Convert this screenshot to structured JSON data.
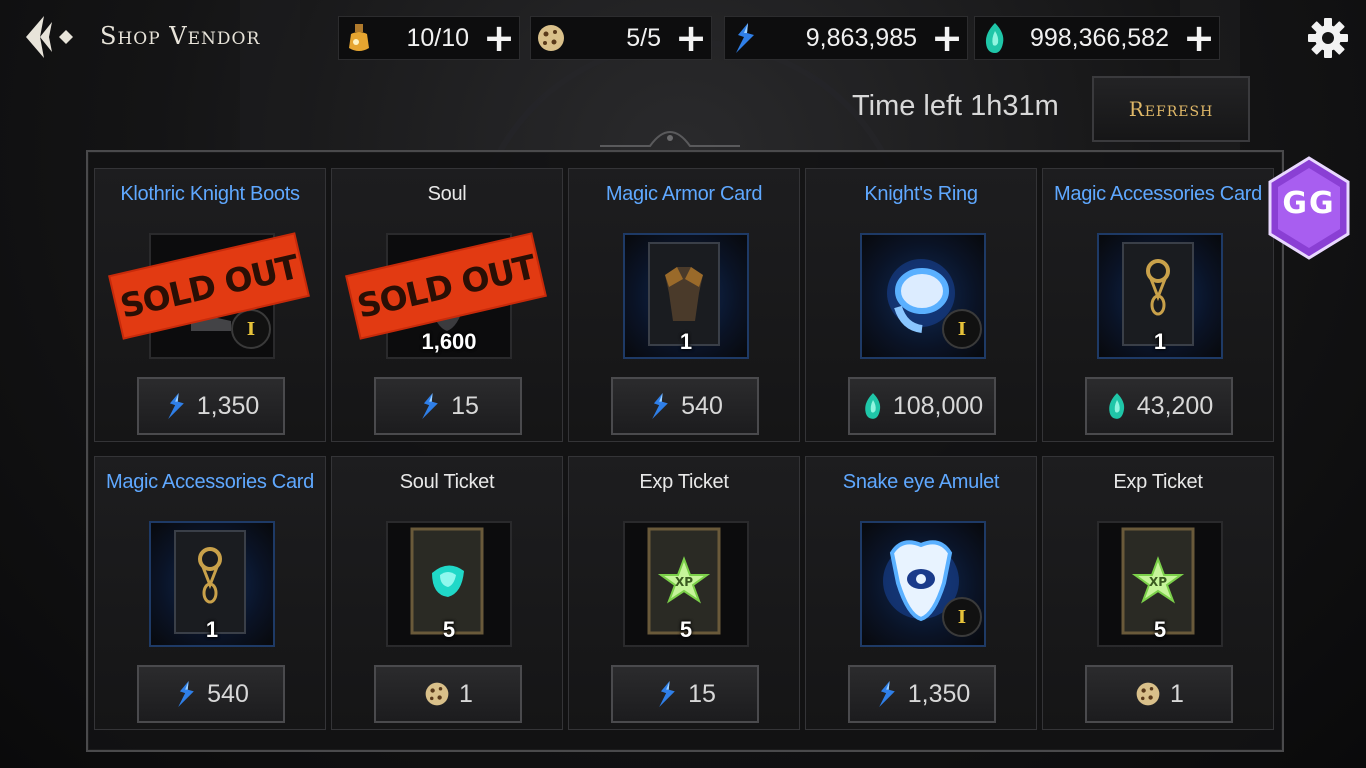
{
  "header": {
    "title": "Shop Vendor",
    "resources": [
      {
        "icon": "stamina-potion-icon",
        "value": "10/10"
      },
      {
        "icon": "cookie-ticket-icon",
        "value": "5/5"
      },
      {
        "icon": "blue-crystal-icon",
        "value": "9,863,985"
      },
      {
        "icon": "green-gem-icon",
        "value": "998,366,582"
      }
    ],
    "plus_label": "+"
  },
  "shop": {
    "time_left": "Time left 1h31m",
    "refresh_label": "Refresh",
    "sold_out_label": "SOLD OUT",
    "items": [
      {
        "name": "Klothric Knight Boots",
        "name_color": "blue",
        "art": "boots-icon",
        "qty": "",
        "grade": "I",
        "sold_out": true,
        "currency": "blue-crystal-icon",
        "price": "1,350"
      },
      {
        "name": "Soul",
        "name_color": "white",
        "art": "soul-icon",
        "qty": "1,600",
        "grade": "",
        "sold_out": true,
        "currency": "blue-crystal-icon",
        "price": "15"
      },
      {
        "name": "Magic Armor Card",
        "name_color": "blue",
        "art": "armor-card-icon",
        "qty": "1",
        "grade": "",
        "sold_out": false,
        "currency": "blue-crystal-icon",
        "price": "540"
      },
      {
        "name": "Knight's Ring",
        "name_color": "blue",
        "art": "ring-icon",
        "qty": "",
        "grade": "I",
        "sold_out": false,
        "currency": "green-gem-icon",
        "price": "108,000"
      },
      {
        "name": "Magic Accessories Card",
        "name_color": "blue",
        "art": "accessory-card-icon",
        "qty": "1",
        "grade": "",
        "sold_out": false,
        "currency": "green-gem-icon",
        "price": "43,200"
      },
      {
        "name": "Magic Accessories Card",
        "name_color": "blue",
        "art": "accessory-card-icon",
        "qty": "1",
        "grade": "",
        "sold_out": false,
        "currency": "blue-crystal-icon",
        "price": "540"
      },
      {
        "name": "Soul Ticket",
        "name_color": "white",
        "art": "soul-ticket-icon",
        "qty": "5",
        "grade": "",
        "sold_out": false,
        "currency": "cookie-ticket-icon",
        "price": "1"
      },
      {
        "name": "Exp Ticket",
        "name_color": "white",
        "art": "exp-ticket-icon",
        "qty": "5",
        "grade": "",
        "sold_out": false,
        "currency": "blue-crystal-icon",
        "price": "15"
      },
      {
        "name": "Snake eye Amulet",
        "name_color": "blue",
        "art": "amulet-icon",
        "qty": "",
        "grade": "I",
        "sold_out": false,
        "currency": "blue-crystal-icon",
        "price": "1,350"
      },
      {
        "name": "Exp Ticket",
        "name_color": "white",
        "art": "exp-ticket-icon",
        "qty": "5",
        "grade": "",
        "sold_out": false,
        "currency": "cookie-ticket-icon",
        "price": "1"
      }
    ]
  },
  "overlay": {
    "gg_label": "GG"
  },
  "colors": {
    "accent_blue": "#5fa8ff",
    "sold_out_red": "#e23a12",
    "refresh_gold": "#e0b868"
  }
}
